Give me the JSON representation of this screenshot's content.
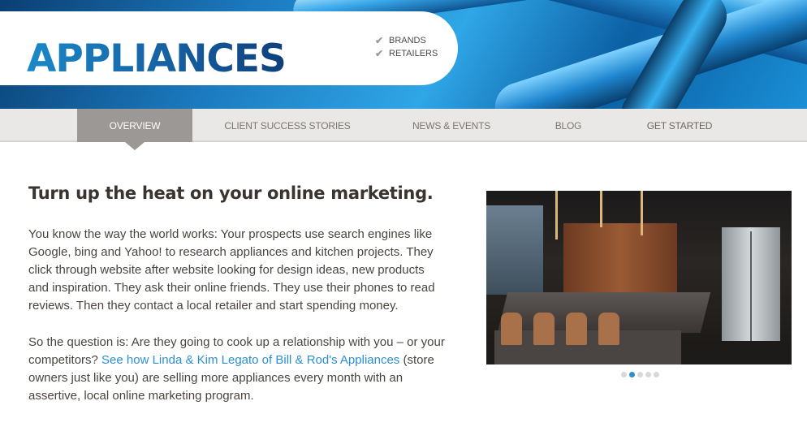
{
  "brand": {
    "logo_text": "APPLIANCES",
    "checklist": [
      {
        "label": "BRANDS"
      },
      {
        "label": "RETAILERS"
      }
    ]
  },
  "nav": {
    "items": [
      {
        "label": "OVERVIEW",
        "active": true
      },
      {
        "label": "CLIENT SUCCESS STORIES",
        "active": false
      },
      {
        "label": "NEWS & EVENTS",
        "active": false
      },
      {
        "label": "BLOG",
        "active": false
      },
      {
        "label": "GET STARTED",
        "active": false
      }
    ]
  },
  "content": {
    "title": "Turn up the heat on your online marketing.",
    "paragraph1": "You know the way the world works: Your prospects use search engines like Google, bing and Yahoo! to research appliances and kitchen projects. They click through website after website looking for design ideas, new products and inspiration. They ask their online friends. They use their phones to read reviews. Then they contact a local retailer and start spending money.",
    "paragraph2_start": "So the question is: Are they going to cook up a relationship with you – or your competitors? ",
    "paragraph2_link": "See how Linda & Kim Legato of Bill & Rod's Appliances",
    "paragraph2_end": " (store owners just like you) are selling more appliances every month with an assertive, local online marketing program."
  },
  "slideshow": {
    "slide_count": 5,
    "active_index": 1
  },
  "colors": {
    "accent": "#2c8fcf",
    "nav_active": "#9b9895",
    "highlight": "#f3dd4a"
  },
  "icons": {
    "check": "check-icon"
  }
}
